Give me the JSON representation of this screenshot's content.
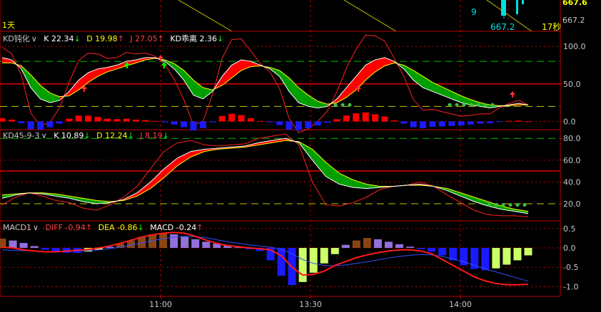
{
  "period_label": "1天",
  "top_pane": {
    "price_marker": "667.2",
    "count": "9",
    "countdown": "17秒",
    "axis_labels": [
      "667.6",
      "667.2"
    ]
  },
  "panes": [
    {
      "id": "kd-dun",
      "name": "KD钝化",
      "menu_glyph": "∨",
      "fields": [
        {
          "label": "K",
          "value": "22.34",
          "arrow": "↓",
          "color": "#ffffff"
        },
        {
          "label": "D",
          "value": "19.98",
          "arrow": "↑",
          "color": "#ffff00"
        },
        {
          "label": "J",
          "value": "27.05",
          "arrow": "↑",
          "color": "#ff4040"
        },
        {
          "label": "KD乖离",
          "value": "2.36",
          "arrow": "↓",
          "color": "#ffffff"
        }
      ],
      "axis_labels": [
        "100.0",
        "50.0",
        "0.0"
      ]
    },
    {
      "id": "kd45",
      "name": "KD45-9-3",
      "menu_glyph": "∨",
      "fields": [
        {
          "label": "K",
          "value": "10.89",
          "arrow": "↓",
          "color": "#ffffff"
        },
        {
          "label": "D",
          "value": "12.24",
          "arrow": "↓",
          "color": "#ffff00"
        },
        {
          "label": "J",
          "value": "8.19",
          "arrow": "↓",
          "color": "#ff4040"
        }
      ],
      "axis_labels": [
        "80.0",
        "60.0",
        "40.0",
        "20.0"
      ]
    },
    {
      "id": "macd",
      "name": "MACD1",
      "menu_glyph": "∨",
      "fields": [
        {
          "label": "DIFF",
          "value": "-0.94",
          "arrow": "↑",
          "color": "#ff4040"
        },
        {
          "label": "DEA",
          "value": "-0.86",
          "arrow": "↓",
          "color": "#ffff00"
        },
        {
          "label": "MACD",
          "value": "-0.24",
          "arrow": "↑",
          "color": "#ffffff"
        }
      ],
      "axis_labels": [
        "0.5",
        "0.0",
        "-0.5",
        "-1.0"
      ]
    }
  ],
  "time_axis": [
    "11:00",
    "13:30",
    "14:00"
  ],
  "colors": {
    "grid_red": "#c00000",
    "guide_green": "#00c000",
    "guide_yellow": "#c8c800",
    "bull": "#ff0000",
    "bear": "#00a000",
    "macd_pos_brown": "#8b4513",
    "macd_pos_violet": "#9370db",
    "macd_neg_blue": "#1a1aff",
    "macd_neg_yellowgreen": "#ccff66"
  },
  "chart_data": [
    {
      "type": "line",
      "title": "KD钝化",
      "ylim": [
        -10,
        120
      ],
      "series": [
        {
          "name": "K",
          "values": [
            85,
            82,
            70,
            45,
            30,
            25,
            28,
            40,
            55,
            65,
            70,
            72,
            75,
            80,
            82,
            85,
            85,
            80,
            70,
            55,
            35,
            30,
            40,
            60,
            75,
            82,
            80,
            75,
            70,
            60,
            40,
            25,
            20,
            18,
            20,
            30,
            45,
            60,
            75,
            82,
            85,
            80,
            70,
            55,
            45,
            40,
            35,
            30,
            25,
            22,
            20,
            18,
            20,
            22,
            24,
            22
          ]
        },
        {
          "name": "D",
          "values": [
            78,
            78,
            74,
            62,
            48,
            38,
            33,
            34,
            42,
            52,
            60,
            66,
            70,
            74,
            78,
            82,
            84,
            82,
            77,
            68,
            55,
            45,
            42,
            48,
            58,
            68,
            73,
            74,
            72,
            68,
            58,
            45,
            35,
            27,
            23,
            25,
            32,
            42,
            55,
            66,
            74,
            78,
            75,
            68,
            60,
            52,
            46,
            40,
            34,
            29,
            25,
            22,
            21,
            21,
            22,
            22
          ]
        },
        {
          "name": "J",
          "values": [
            99,
            90,
            62,
            11,
            -6,
            -1,
            18,
            52,
            81,
            91,
            90,
            84,
            85,
            92,
            90,
            91,
            87,
            76,
            56,
            29,
            -5,
            0,
            36,
            84,
            109,
            110,
            94,
            77,
            66,
            44,
            4,
            -15,
            -10,
            0,
            14,
            40,
            71,
            96,
            115,
            114,
            107,
            84,
            60,
            29,
            15,
            16,
            13,
            10,
            7,
            8,
            10,
            10,
            18,
            24,
            28,
            22
          ]
        }
      ]
    },
    {
      "type": "line",
      "title": "KD45-9-3",
      "ylim": [
        5,
        88
      ],
      "series": [
        {
          "name": "K",
          "values": [
            25,
            28,
            30,
            29,
            27,
            25,
            22,
            20,
            21,
            24,
            30,
            40,
            52,
            62,
            68,
            70,
            71,
            72,
            73,
            76,
            78,
            80,
            76,
            60,
            45,
            38,
            35,
            34,
            35,
            36,
            37,
            38,
            36,
            32,
            27,
            22,
            18,
            15,
            13,
            11
          ]
        },
        {
          "name": "D",
          "values": [
            28,
            29,
            30,
            30,
            29,
            27,
            25,
            23,
            22,
            23,
            27,
            34,
            44,
            55,
            63,
            68,
            70,
            71,
            72,
            74,
            76,
            78,
            77,
            70,
            58,
            48,
            42,
            38,
            36,
            36,
            37,
            37,
            36,
            34,
            30,
            26,
            22,
            18,
            15,
            13
          ]
        },
        {
          "name": "J",
          "values": [
            19,
            26,
            30,
            27,
            23,
            21,
            16,
            14,
            19,
            26,
            36,
            52,
            68,
            76,
            78,
            74,
            73,
            74,
            75,
            80,
            82,
            84,
            74,
            40,
            19,
            18,
            21,
            26,
            33,
            36,
            37,
            40,
            36,
            28,
            21,
            14,
            10,
            9,
            9,
            8
          ]
        }
      ]
    },
    {
      "type": "bar",
      "title": "MACD1",
      "ylim": [
        -1.25,
        0.7
      ],
      "macd_values": [
        0.15,
        0.12,
        0.08,
        0.03,
        -0.03,
        -0.06,
        -0.08,
        -0.08,
        -0.06,
        -0.03,
        0.02,
        0.07,
        0.12,
        0.18,
        0.22,
        0.24,
        0.22,
        0.18,
        0.14,
        0.1,
        0.07,
        0.04,
        0.01,
        -0.02,
        -0.05,
        -0.2,
        -0.45,
        -0.6,
        -0.55,
        -0.4,
        -0.25,
        -0.1,
        0.05,
        0.12,
        0.16,
        0.14,
        0.1,
        0.06,
        0.02,
        -0.02,
        -0.06,
        -0.12,
        -0.2,
        -0.28,
        -0.34,
        -0.36,
        -0.33,
        -0.27,
        -0.2,
        -0.12
      ],
      "series": [
        {
          "name": "DIFF",
          "values": [
            0.02,
            0.0,
            -0.05,
            -0.08,
            -0.1,
            -0.1,
            -0.08,
            -0.06,
            -0.04,
            0.0,
            0.05,
            0.12,
            0.2,
            0.28,
            0.34,
            0.38,
            0.4,
            0.38,
            0.3,
            0.2,
            0.12,
            0.06,
            0.03,
            0.0,
            -0.02,
            -0.05,
            -0.2,
            -0.5,
            -0.7,
            -0.68,
            -0.6,
            -0.45,
            -0.35,
            -0.25,
            -0.18,
            -0.12,
            -0.08,
            -0.05,
            -0.05,
            -0.08,
            -0.15,
            -0.3,
            -0.45,
            -0.6,
            -0.75,
            -0.85,
            -0.92,
            -0.95,
            -0.95,
            -0.94
          ]
        },
        {
          "name": "DEA",
          "values": [
            -0.05,
            -0.06,
            -0.07,
            -0.08,
            -0.09,
            -0.09,
            -0.09,
            -0.08,
            -0.07,
            -0.05,
            -0.02,
            0.02,
            0.07,
            0.13,
            0.19,
            0.24,
            0.28,
            0.3,
            0.29,
            0.26,
            0.21,
            0.16,
            0.12,
            0.08,
            0.05,
            0.02,
            -0.04,
            -0.15,
            -0.3,
            -0.4,
            -0.45,
            -0.46,
            -0.44,
            -0.4,
            -0.36,
            -0.31,
            -0.26,
            -0.22,
            -0.19,
            -0.17,
            -0.18,
            -0.22,
            -0.28,
            -0.36,
            -0.45,
            -0.54,
            -0.62,
            -0.7,
            -0.78,
            -0.86
          ]
        }
      ]
    }
  ]
}
